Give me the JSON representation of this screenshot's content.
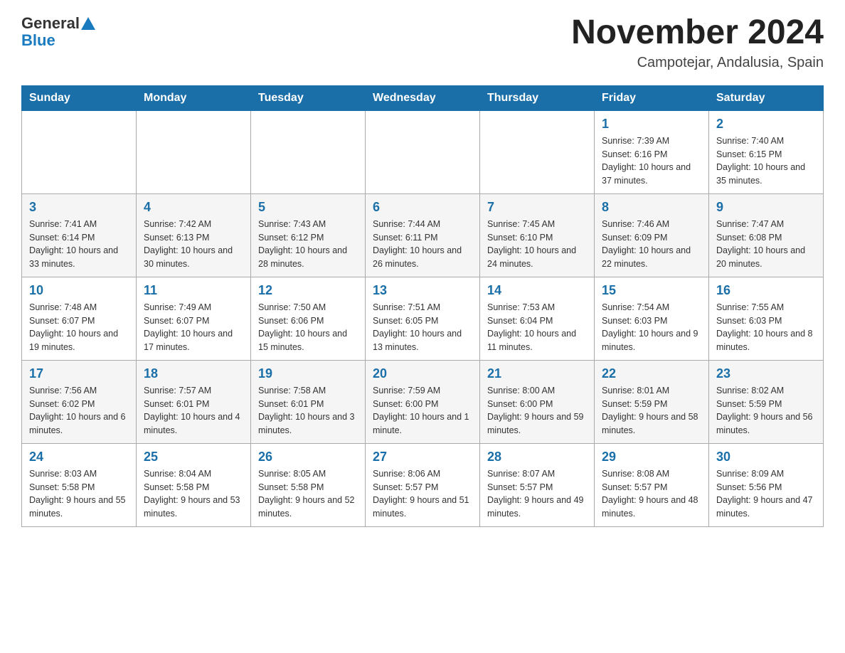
{
  "header": {
    "logo_general": "General",
    "logo_blue": "Blue",
    "month_title": "November 2024",
    "location": "Campotejar, Andalusia, Spain"
  },
  "days_of_week": [
    "Sunday",
    "Monday",
    "Tuesday",
    "Wednesday",
    "Thursday",
    "Friday",
    "Saturday"
  ],
  "weeks": [
    {
      "days": [
        {
          "number": "",
          "info": ""
        },
        {
          "number": "",
          "info": ""
        },
        {
          "number": "",
          "info": ""
        },
        {
          "number": "",
          "info": ""
        },
        {
          "number": "",
          "info": ""
        },
        {
          "number": "1",
          "info": "Sunrise: 7:39 AM\nSunset: 6:16 PM\nDaylight: 10 hours and 37 minutes."
        },
        {
          "number": "2",
          "info": "Sunrise: 7:40 AM\nSunset: 6:15 PM\nDaylight: 10 hours and 35 minutes."
        }
      ]
    },
    {
      "days": [
        {
          "number": "3",
          "info": "Sunrise: 7:41 AM\nSunset: 6:14 PM\nDaylight: 10 hours and 33 minutes."
        },
        {
          "number": "4",
          "info": "Sunrise: 7:42 AM\nSunset: 6:13 PM\nDaylight: 10 hours and 30 minutes."
        },
        {
          "number": "5",
          "info": "Sunrise: 7:43 AM\nSunset: 6:12 PM\nDaylight: 10 hours and 28 minutes."
        },
        {
          "number": "6",
          "info": "Sunrise: 7:44 AM\nSunset: 6:11 PM\nDaylight: 10 hours and 26 minutes."
        },
        {
          "number": "7",
          "info": "Sunrise: 7:45 AM\nSunset: 6:10 PM\nDaylight: 10 hours and 24 minutes."
        },
        {
          "number": "8",
          "info": "Sunrise: 7:46 AM\nSunset: 6:09 PM\nDaylight: 10 hours and 22 minutes."
        },
        {
          "number": "9",
          "info": "Sunrise: 7:47 AM\nSunset: 6:08 PM\nDaylight: 10 hours and 20 minutes."
        }
      ]
    },
    {
      "days": [
        {
          "number": "10",
          "info": "Sunrise: 7:48 AM\nSunset: 6:07 PM\nDaylight: 10 hours and 19 minutes."
        },
        {
          "number": "11",
          "info": "Sunrise: 7:49 AM\nSunset: 6:07 PM\nDaylight: 10 hours and 17 minutes."
        },
        {
          "number": "12",
          "info": "Sunrise: 7:50 AM\nSunset: 6:06 PM\nDaylight: 10 hours and 15 minutes."
        },
        {
          "number": "13",
          "info": "Sunrise: 7:51 AM\nSunset: 6:05 PM\nDaylight: 10 hours and 13 minutes."
        },
        {
          "number": "14",
          "info": "Sunrise: 7:53 AM\nSunset: 6:04 PM\nDaylight: 10 hours and 11 minutes."
        },
        {
          "number": "15",
          "info": "Sunrise: 7:54 AM\nSunset: 6:03 PM\nDaylight: 10 hours and 9 minutes."
        },
        {
          "number": "16",
          "info": "Sunrise: 7:55 AM\nSunset: 6:03 PM\nDaylight: 10 hours and 8 minutes."
        }
      ]
    },
    {
      "days": [
        {
          "number": "17",
          "info": "Sunrise: 7:56 AM\nSunset: 6:02 PM\nDaylight: 10 hours and 6 minutes."
        },
        {
          "number": "18",
          "info": "Sunrise: 7:57 AM\nSunset: 6:01 PM\nDaylight: 10 hours and 4 minutes."
        },
        {
          "number": "19",
          "info": "Sunrise: 7:58 AM\nSunset: 6:01 PM\nDaylight: 10 hours and 3 minutes."
        },
        {
          "number": "20",
          "info": "Sunrise: 7:59 AM\nSunset: 6:00 PM\nDaylight: 10 hours and 1 minute."
        },
        {
          "number": "21",
          "info": "Sunrise: 8:00 AM\nSunset: 6:00 PM\nDaylight: 9 hours and 59 minutes."
        },
        {
          "number": "22",
          "info": "Sunrise: 8:01 AM\nSunset: 5:59 PM\nDaylight: 9 hours and 58 minutes."
        },
        {
          "number": "23",
          "info": "Sunrise: 8:02 AM\nSunset: 5:59 PM\nDaylight: 9 hours and 56 minutes."
        }
      ]
    },
    {
      "days": [
        {
          "number": "24",
          "info": "Sunrise: 8:03 AM\nSunset: 5:58 PM\nDaylight: 9 hours and 55 minutes."
        },
        {
          "number": "25",
          "info": "Sunrise: 8:04 AM\nSunset: 5:58 PM\nDaylight: 9 hours and 53 minutes."
        },
        {
          "number": "26",
          "info": "Sunrise: 8:05 AM\nSunset: 5:58 PM\nDaylight: 9 hours and 52 minutes."
        },
        {
          "number": "27",
          "info": "Sunrise: 8:06 AM\nSunset: 5:57 PM\nDaylight: 9 hours and 51 minutes."
        },
        {
          "number": "28",
          "info": "Sunrise: 8:07 AM\nSunset: 5:57 PM\nDaylight: 9 hours and 49 minutes."
        },
        {
          "number": "29",
          "info": "Sunrise: 8:08 AM\nSunset: 5:57 PM\nDaylight: 9 hours and 48 minutes."
        },
        {
          "number": "30",
          "info": "Sunrise: 8:09 AM\nSunset: 5:56 PM\nDaylight: 9 hours and 47 minutes."
        }
      ]
    }
  ]
}
